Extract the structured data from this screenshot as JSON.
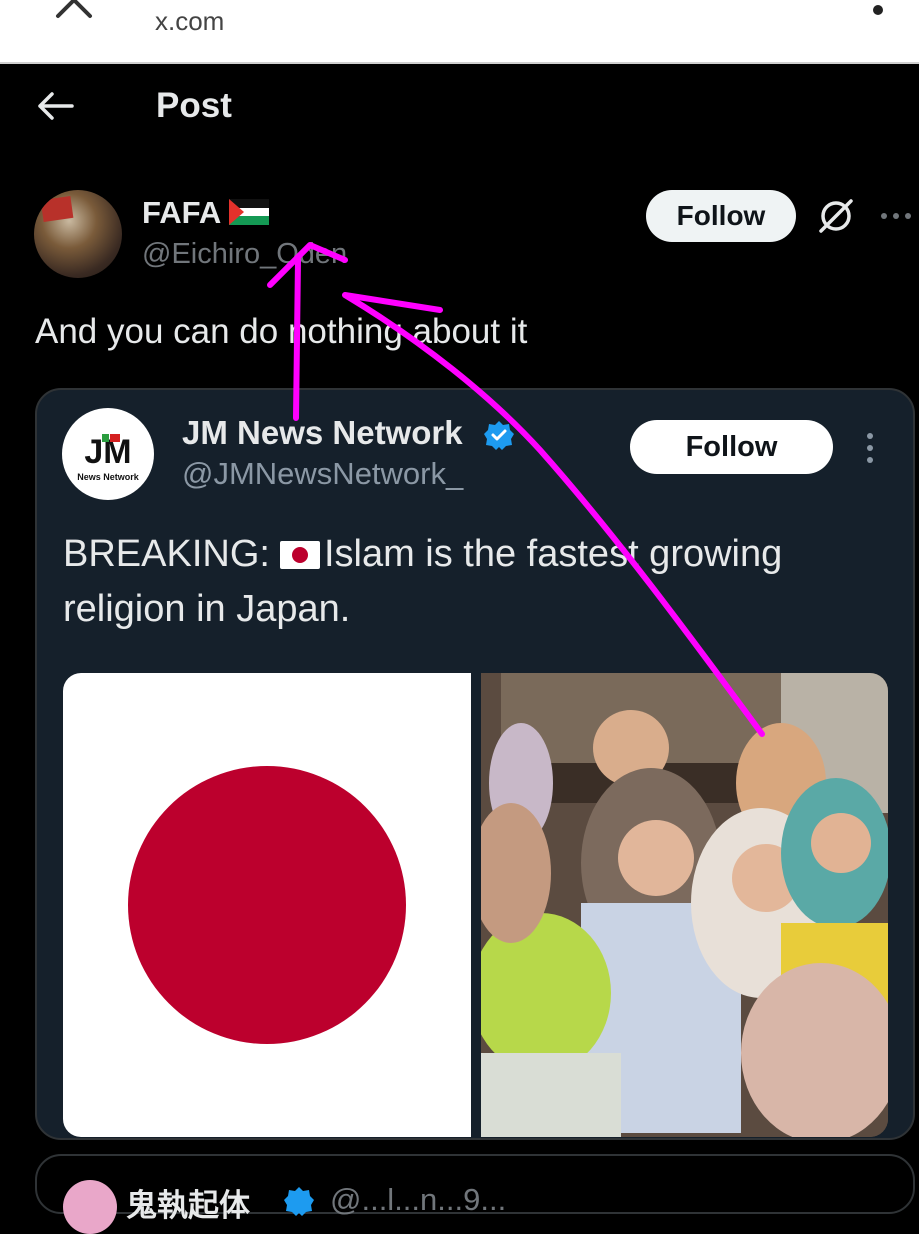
{
  "browser": {
    "url": "x.com",
    "close_icon": "close-icon",
    "menu_icon": "more-vertical-icon"
  },
  "header": {
    "title": "Post",
    "back_icon": "arrow-left-icon"
  },
  "post": {
    "author_name": "FAFA",
    "author_flag": "palestine-flag-emoji",
    "author_handle": "@Eichiro_Oden",
    "follow_label": "Follow",
    "text": "And you can do nothing about it"
  },
  "quoted_post": {
    "author_name": "JM News Network",
    "author_handle": "@JMNewsNetwork_",
    "verified": true,
    "follow_label": "Follow",
    "text_before_flag": "BREAKING:",
    "flag": "japan-flag-emoji",
    "text_after_flag": "Islam is the fastest growing religion in Japan.",
    "avatar_logo_text": "JM",
    "avatar_logo_sub": "News Network",
    "media": [
      {
        "kind": "image",
        "description_icon": "japan-flag-image"
      },
      {
        "kind": "image",
        "description_icon": "crowd-photo"
      }
    ]
  },
  "next_post": {
    "author_name": "鬼執起体",
    "author_handle": "@...l...n...9..."
  },
  "colors": {
    "background": "#000000",
    "quote_card": "#15202b",
    "annotation": "#ff00ff",
    "hinomaru_red": "#bc002d",
    "verified_blue": "#1d9bf0"
  }
}
